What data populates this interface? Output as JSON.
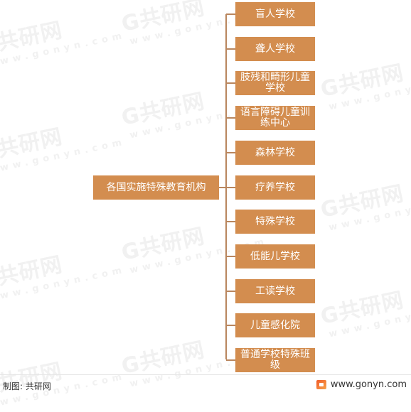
{
  "diagram": {
    "root": {
      "label": "各国实施特殊教育机构"
    },
    "children": [
      {
        "label": "盲人学校"
      },
      {
        "label": "聋人学校"
      },
      {
        "label": "肢残和畸形儿童学校"
      },
      {
        "label": "语言障碍儿童训练中心"
      },
      {
        "label": "森林学校"
      },
      {
        "label": "疗养学校"
      },
      {
        "label": "特殊学校"
      },
      {
        "label": "低能儿学校"
      },
      {
        "label": "工读学校"
      },
      {
        "label": "儿童感化院"
      },
      {
        "label": "普通学校特殊班级"
      }
    ],
    "colors": {
      "box": "#d38d4f",
      "connector": "#b9865e",
      "text": "#ffffff"
    }
  },
  "watermark": {
    "brand": "G共研网",
    "url": "www.gonyn.com"
  },
  "footer": {
    "credit": "制图: 共研网",
    "site": "www.gonyn.com",
    "logo_icon": "gonyn-logo-icon"
  }
}
